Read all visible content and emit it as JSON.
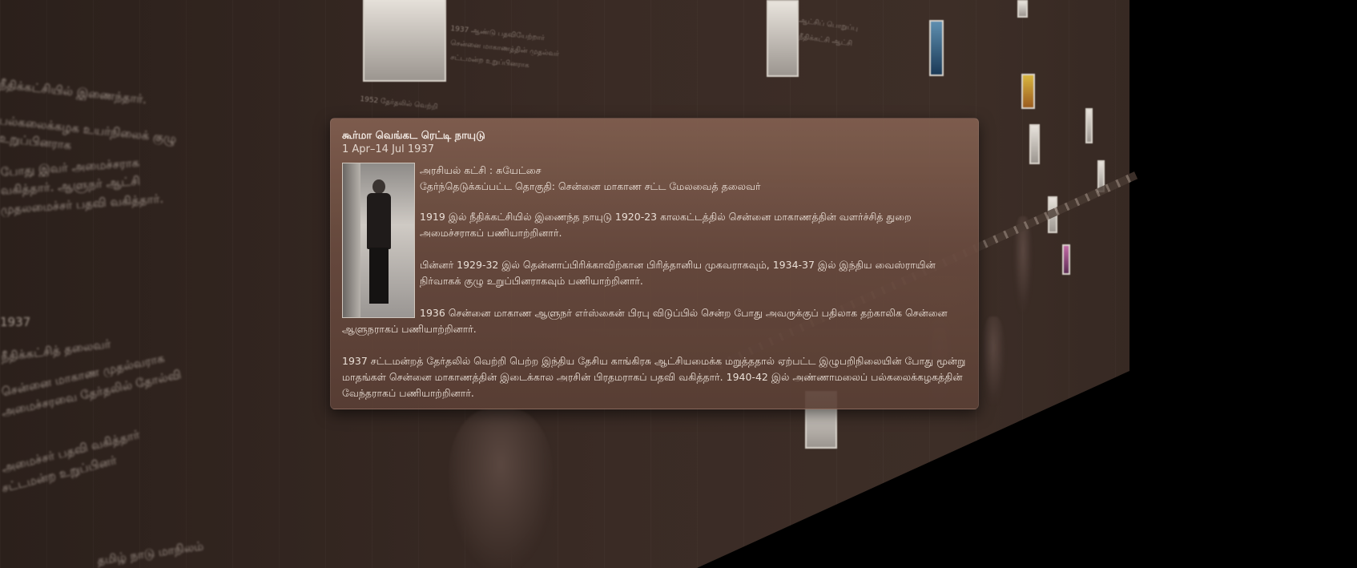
{
  "card": {
    "title": "கூர்மா வெங்கட ரெட்டி நாயுடு",
    "date": "1 Apr–14 Jul 1937",
    "party": "அரசியல் கட்சி : சுயேட்சை",
    "constituency": "தேர்ந்தெடுக்கப்பட்ட தொகுதி: சென்னை மாகாண சட்ட மேலவைத் தலைவர்",
    "paragraphs": [
      "1919 இல் நீதிக்கட்சியில் இணைந்த நாயுடு 1920-23 காலகட்டத்தில் சென்னை மாகாணத்தின் வளர்ச்சித் துறை அமைச்சராகப் பணியாற்றினார்.",
      "பின்னர் 1929-32 இல் தென்னாப்பிரிக்காவிற்கான பிரித்தானிய முகவராகவும், 1934-37 இல் இந்திய வைஸ்ராயின் நிர்வாகக் குழு உறுப்பினராகவும் பணியாற்றினார்.",
      "1936 சென்னை மாகாண ஆளுநர் எர்ஸ்கைன் பிரபு விடுப்பில் சென்ற போது அவருக்குப் பதிலாக தற்காலிக சென்னை ஆளுநராகப் பணியாற்றினார்.",
      "1937 சட்டமன்றத் தேர்தலில் வெற்றி பெற்ற இந்திய தேசிய காங்கிரசு ஆட்சியமைக்க மறுத்ததால் ஏற்பட்ட இழுபறிநிலையின் போது மூன்று மாதங்கள் சென்னை மாகாணத்தின் இடைக்கால அரசின் பிரதமராகப் பதவி வகித்தார். 1940-42 இல் அண்ணாமலைப் பல்கலைக்கழகத்தின் வேந்தராகப் பணியாற்றினார்."
    ]
  },
  "background": {
    "left_lines": [
      "நீதிக்கட்சியில் இணைந்தார்.",
      "பல்கலைக்கழக உயர்நிலைக் குழு",
      "உறுப்பினராக",
      "போது இவர் அமைச்சராக",
      "வகித்தார். ஆளுநர் ஆட்சி",
      "முதலமைச்சர் பதவி வகித்தார்.",
      "1937",
      "நீதிக்கட்சித் தலைவர்",
      "சென்னை மாகாண முதல்வராக",
      "அமைச்சரவை தேர்தலில் தோல்வி",
      "அமைச்சர் பதவி வகித்தார்",
      "சட்டமன்ற உறுப்பினர்",
      "தமிழ் நாடு மாநிலம்"
    ],
    "mid_lines": [
      "1937 ஆண்டு பதவியேற்றார்",
      "சென்னை மாகாணத்தின் முதல்வர்",
      "சட்டமன்ற உறுப்பினராக",
      "1952 தேர்தலில் வெற்றி",
      "ஆட்சிப் பொறுப்பு",
      "நீதிக்கட்சி ஆட்சி"
    ]
  }
}
